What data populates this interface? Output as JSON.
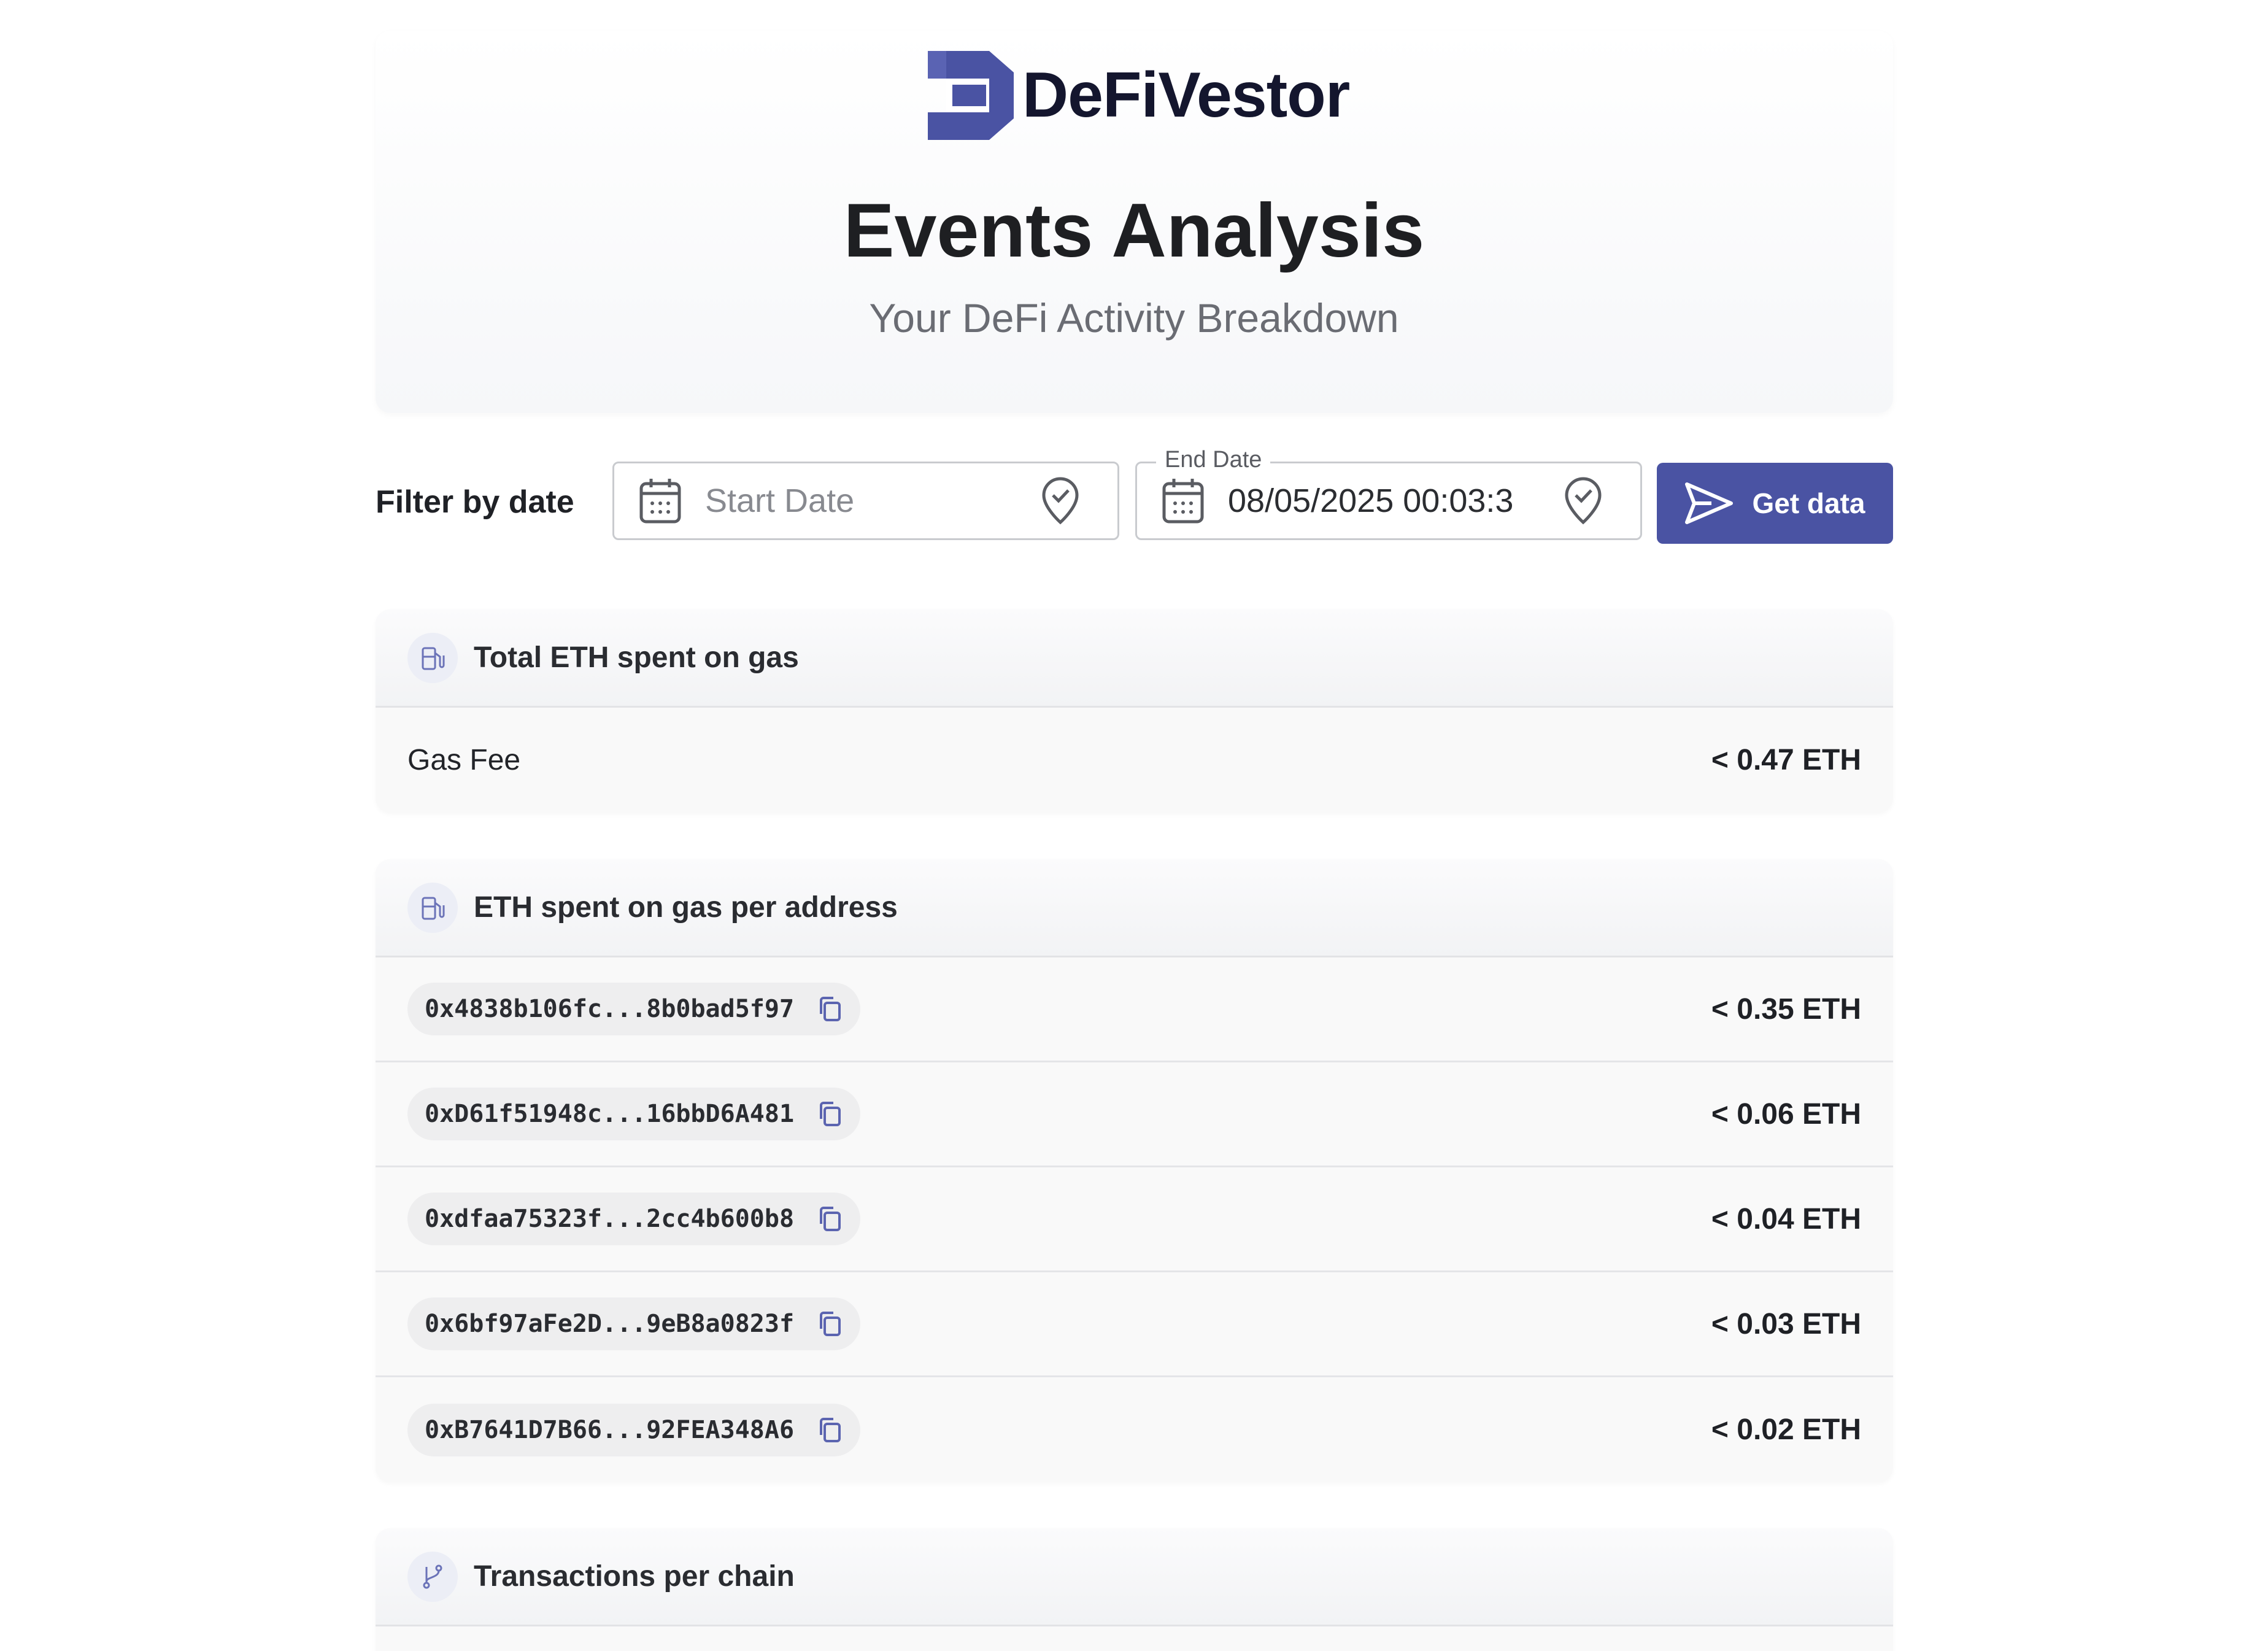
{
  "brand": {
    "name": "DeFiVestor",
    "color": "#4a53a3"
  },
  "page": {
    "title": "Events Analysis",
    "subtitle": "Your DeFi Activity Breakdown"
  },
  "filter": {
    "label": "Filter by date",
    "start_date": {
      "placeholder": "Start Date",
      "value": ""
    },
    "end_date": {
      "label": "End Date",
      "value": "08/05/2025 00:03:3"
    },
    "submit_label": "Get data"
  },
  "sections": {
    "total_gas": {
      "title": "Total ETH spent on gas",
      "icon": "fuel-pump-icon",
      "rows": [
        {
          "label": "Gas Fee",
          "value": "< 0.47 ETH"
        }
      ]
    },
    "gas_per_address": {
      "title": "ETH spent on gas per address",
      "icon": "fuel-pump-icon",
      "rows": [
        {
          "address": "0x4838b106fc...8b0bad5f97",
          "value": "< 0.35 ETH"
        },
        {
          "address": "0xD61f51948c...16bbD6A481",
          "value": "< 0.06 ETH"
        },
        {
          "address": "0xdfaa75323f...2cc4b600b8",
          "value": "< 0.04 ETH"
        },
        {
          "address": "0x6bf97aFe2D...9eB8a0823f",
          "value": "< 0.03 ETH"
        },
        {
          "address": "0xB7641D7B66...92FEA348A6",
          "value": "< 0.02 ETH"
        }
      ]
    },
    "tx_per_chain": {
      "title": "Transactions per chain",
      "icon": "git-branch-icon"
    }
  }
}
